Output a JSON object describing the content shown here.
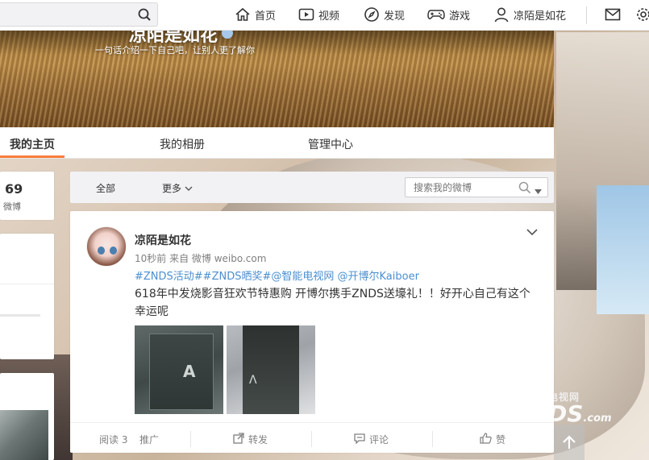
{
  "topnav": {
    "search_placeholder": "",
    "items": [
      {
        "label": "首页",
        "icon": "home-icon"
      },
      {
        "label": "视频",
        "icon": "video-icon"
      },
      {
        "label": "发现",
        "icon": "compass-icon"
      },
      {
        "label": "游戏",
        "icon": "gamepad-icon"
      },
      {
        "label": "凉陌是如花",
        "icon": "user-icon"
      }
    ],
    "icons": [
      "mail-icon",
      "gear-icon"
    ]
  },
  "profile": {
    "name": "凉陌是如花",
    "bio": "一句话介绍一下自己吧，让别人更了解你"
  },
  "tabs": [
    {
      "label": "我的主页",
      "active": true
    },
    {
      "label": "我的相册",
      "active": false
    },
    {
      "label": "管理中心",
      "active": false
    }
  ],
  "stats": {
    "count": "69",
    "label": "微博"
  },
  "filter": {
    "all_label": "全部",
    "more_label": "更多",
    "search_placeholder": "搜索我的微博"
  },
  "post": {
    "author": "凉陌是如花",
    "meta": "10秒前 来自 微博 weibo.com",
    "tags": "#ZNDS活动##ZNDS晒奖#@智能电视网 @开博尔Kaiboer",
    "text": "618年中发烧影音狂欢节特惠购 开博尔携手ZNDS送壕礼！！好开心自己有这个幸运呢",
    "actions": {
      "read": "阅读 3",
      "promote": "推广",
      "repost": "转发",
      "comment": "评论",
      "like": "赞"
    }
  },
  "watermark": {
    "line1": "电视网",
    "line2": "DS",
    "suffix": ".com"
  },
  "colors": {
    "accent": "#fa7d3c",
    "link": "#4b8fd0"
  }
}
